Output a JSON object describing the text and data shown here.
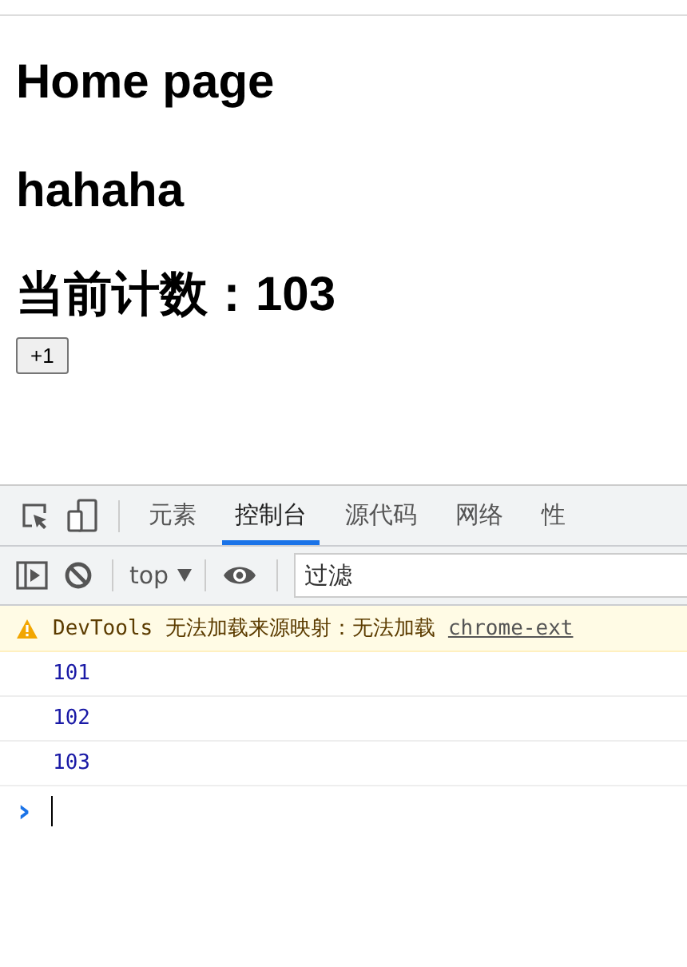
{
  "page": {
    "headings": [
      "Home page",
      "hahaha",
      "当前计数：103"
    ],
    "button": "+1"
  },
  "devtools": {
    "tabs": [
      {
        "label": "元素",
        "selected": false
      },
      {
        "label": "控制台",
        "selected": true
      },
      {
        "label": "源代码",
        "selected": false
      },
      {
        "label": "网络",
        "selected": false
      },
      {
        "label": "性",
        "selected": false
      }
    ],
    "context": "top",
    "filter": {
      "placeholder": "过滤"
    },
    "warning": {
      "text": "DevTools 无法加载来源映射：无法加载",
      "link": "chrome-ext"
    },
    "logs": [
      "101",
      "102",
      "103"
    ],
    "prompt": "›"
  }
}
